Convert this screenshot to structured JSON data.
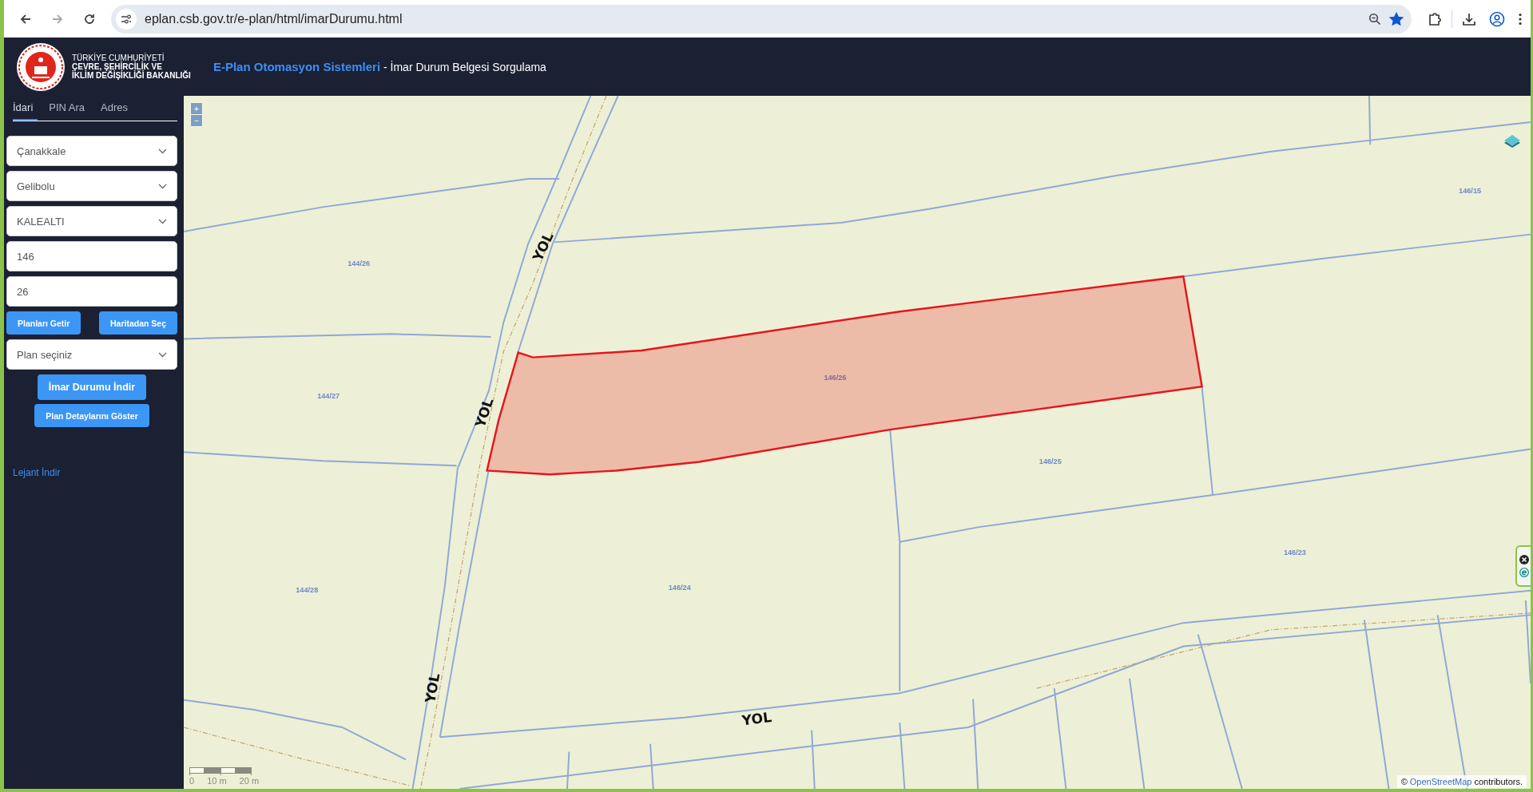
{
  "browser": {
    "nav": [
      {
        "kind": "back",
        "disabled": false
      },
      {
        "kind": "forward",
        "disabled": true
      },
      {
        "kind": "reload",
        "disabled": false
      }
    ],
    "url": "eplan.csb.gov.tr/e-plan/html/imarDurumu.html",
    "bookmarked": true
  },
  "header": {
    "org_lines": [
      "TÜRKİYE CUMHURİYETİ",
      "ÇEVRE, ŞEHİRCİLİK VE",
      "İKLİM DEĞİŞİKLİĞİ BAKANLIĞI"
    ],
    "app_title": "E-Plan Otomasyon Sistemleri",
    "page_title": " - İmar Durum Belgesi Sorgulama"
  },
  "sidebar": {
    "tabs": [
      {
        "label": "İdari",
        "selected": true
      },
      {
        "label": "PIN Ara",
        "selected": false
      },
      {
        "label": "Adres",
        "selected": false
      }
    ],
    "fields": [
      {
        "kind": "select",
        "value": "Çanakkale"
      },
      {
        "kind": "select",
        "value": "Gelibolu"
      },
      {
        "kind": "select",
        "value": "KALEALTI"
      },
      {
        "kind": "input",
        "value": "146"
      },
      {
        "kind": "input",
        "value": "26"
      }
    ],
    "query_buttons": [
      "Planları Getir",
      "Haritadan Seç"
    ],
    "plan_select": {
      "value": "Plan seçiniz"
    },
    "actions": [
      {
        "label": "İmar Durumu İndir",
        "kind": "large"
      },
      {
        "label": "Plan Detaylarını Göster",
        "kind": "small"
      }
    ],
    "legend_link": "Lejant İndir"
  },
  "map": {
    "zoom_buttons": [
      "+",
      "−"
    ],
    "parcels": [
      {
        "label": "144/26",
        "selected": false
      },
      {
        "label": "144/27",
        "selected": false
      },
      {
        "label": "144/28",
        "selected": false
      },
      {
        "label": "146/26",
        "selected": true
      },
      {
        "label": "146/25",
        "selected": false
      },
      {
        "label": "146/24",
        "selected": false
      },
      {
        "label": "146/23",
        "selected": false
      },
      {
        "label": "146/15",
        "selected": false
      }
    ],
    "road_labels": [
      "YOL",
      "YOL",
      "YOL",
      "YOL"
    ],
    "scale": {
      "ticks": [
        "0",
        "10 m",
        "20 m"
      ]
    },
    "attribution": {
      "prefix": "©",
      "link": "OpenStreetMap",
      "suffix": "contributors."
    }
  }
}
